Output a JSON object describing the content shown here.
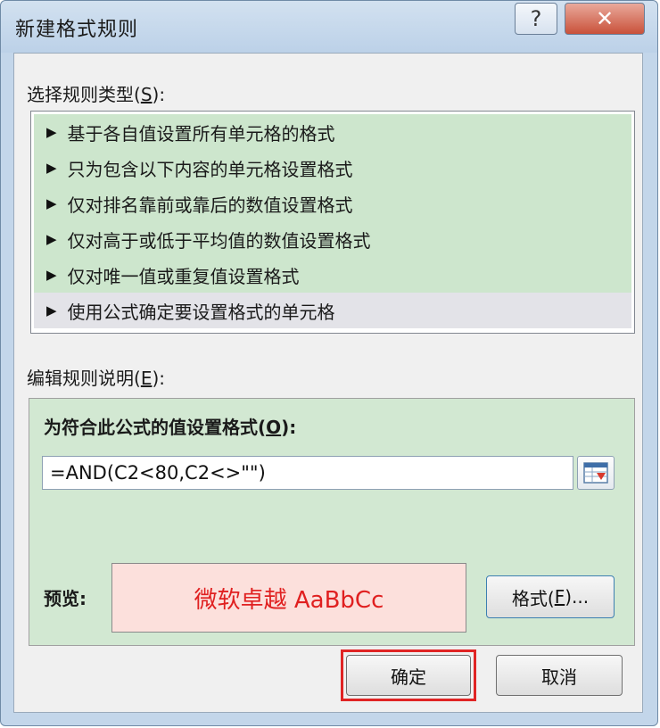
{
  "window": {
    "title": "新建格式规则",
    "help_glyph": "?",
    "close_glyph": "✕"
  },
  "rule_type": {
    "label_pre": "选择规则类型(",
    "label_key": "S",
    "label_post": "):",
    "items": [
      "基于各自值设置所有单元格的格式",
      "只为包含以下内容的单元格设置格式",
      "仅对排名靠前或靠后的数值设置格式",
      "仅对高于或低于平均值的数值设置格式",
      "仅对唯一值或重复值设置格式",
      "使用公式确定要设置格式的单元格"
    ],
    "selected_index": 5,
    "arrow_glyph": "▶"
  },
  "description": {
    "label_pre": "编辑规则说明(",
    "label_key": "E",
    "label_post": "):",
    "heading_pre": "为符合此公式的值设置格式(",
    "heading_key": "O",
    "heading_post": "):",
    "formula_value": "=AND(C2<80,C2<>\"\")",
    "preview_label": "预览:",
    "preview_text": "微软卓越  AaBbCc",
    "format_button_pre": "格式(",
    "format_button_key": "F",
    "format_button_post": ")..."
  },
  "buttons": {
    "ok": "确定",
    "cancel": "取消"
  },
  "colors": {
    "list_item_bg": "#cde6cd",
    "selected_item_bg": "#e3e3e8",
    "panel_bg": "#d2e8d2",
    "preview_bg": "#fce0dc",
    "preview_text": "#e02020",
    "highlight_border": "#e02424"
  }
}
